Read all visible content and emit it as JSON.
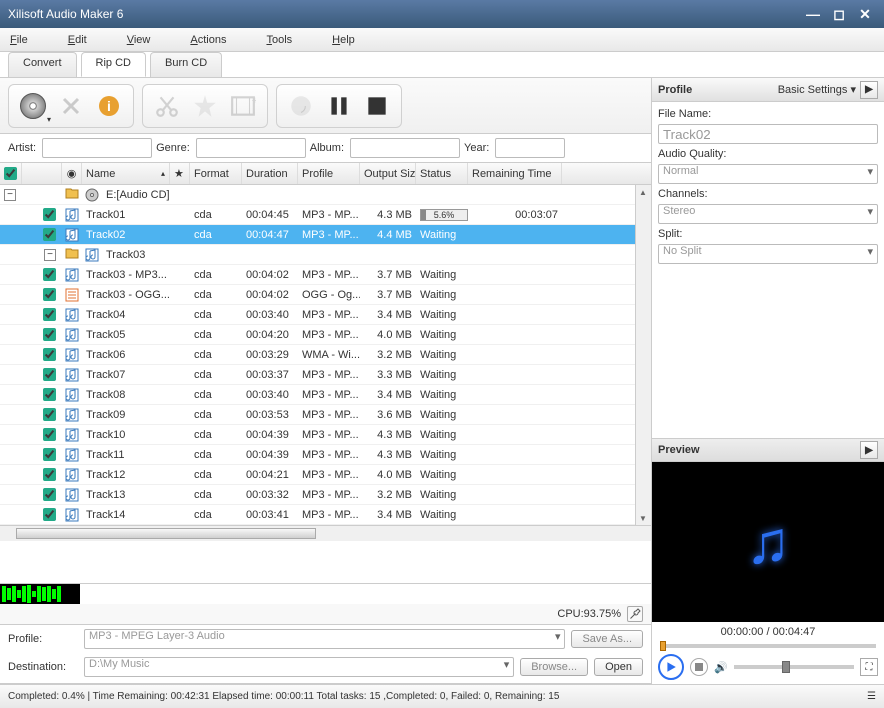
{
  "window": {
    "title": "Xilisoft Audio Maker 6"
  },
  "menu": {
    "file": "File",
    "edit": "Edit",
    "view": "View",
    "actions": "Actions",
    "tools": "Tools",
    "help": "Help"
  },
  "tabs": {
    "convert": "Convert",
    "ripcd": "Rip CD",
    "burncd": "Burn CD"
  },
  "meta": {
    "artist_label": "Artist:",
    "genre_label": "Genre:",
    "album_label": "Album:",
    "year_label": "Year:"
  },
  "headers": {
    "name": "Name",
    "format": "Format",
    "duration": "Duration",
    "profile": "Profile",
    "output_size": "Output Size",
    "status": "Status",
    "remaining_time": "Remaining Time"
  },
  "folders": {
    "cd": "E:[Audio CD]",
    "track03": "Track03"
  },
  "tracks": [
    {
      "name": "Track01",
      "format": "cda",
      "duration": "00:04:45",
      "profile": "MP3 - MP...",
      "output": "4.3 MB",
      "status_pct": "5.6%",
      "remaining": "00:03:07",
      "selected": false,
      "progress": true
    },
    {
      "name": "Track02",
      "format": "cda",
      "duration": "00:04:47",
      "profile": "MP3 - MP...",
      "output": "4.4 MB",
      "status": "Waiting",
      "remaining": "",
      "selected": true
    },
    {
      "name": "Track03 - MP3...",
      "format": "cda",
      "duration": "00:04:02",
      "profile": "MP3 - MP...",
      "output": "3.7 MB",
      "status": "Waiting",
      "remaining": ""
    },
    {
      "name": "Track03 - OGG...",
      "format": "cda",
      "duration": "00:04:02",
      "profile": "OGG - Og...",
      "output": "3.7 MB",
      "status": "Waiting",
      "remaining": "",
      "ogg": true
    },
    {
      "name": "Track04",
      "format": "cda",
      "duration": "00:03:40",
      "profile": "MP3 - MP...",
      "output": "3.4 MB",
      "status": "Waiting",
      "remaining": ""
    },
    {
      "name": "Track05",
      "format": "cda",
      "duration": "00:04:20",
      "profile": "MP3 - MP...",
      "output": "4.0 MB",
      "status": "Waiting",
      "remaining": ""
    },
    {
      "name": "Track06",
      "format": "cda",
      "duration": "00:03:29",
      "profile": "WMA - Wi...",
      "output": "3.2 MB",
      "status": "Waiting",
      "remaining": ""
    },
    {
      "name": "Track07",
      "format": "cda",
      "duration": "00:03:37",
      "profile": "MP3 - MP...",
      "output": "3.3 MB",
      "status": "Waiting",
      "remaining": ""
    },
    {
      "name": "Track08",
      "format": "cda",
      "duration": "00:03:40",
      "profile": "MP3 - MP...",
      "output": "3.4 MB",
      "status": "Waiting",
      "remaining": ""
    },
    {
      "name": "Track09",
      "format": "cda",
      "duration": "00:03:53",
      "profile": "MP3 - MP...",
      "output": "3.6 MB",
      "status": "Waiting",
      "remaining": ""
    },
    {
      "name": "Track10",
      "format": "cda",
      "duration": "00:04:39",
      "profile": "MP3 - MP...",
      "output": "4.3 MB",
      "status": "Waiting",
      "remaining": ""
    },
    {
      "name": "Track11",
      "format": "cda",
      "duration": "00:04:39",
      "profile": "MP3 - MP...",
      "output": "4.3 MB",
      "status": "Waiting",
      "remaining": ""
    },
    {
      "name": "Track12",
      "format": "cda",
      "duration": "00:04:21",
      "profile": "MP3 - MP...",
      "output": "4.0 MB",
      "status": "Waiting",
      "remaining": ""
    },
    {
      "name": "Track13",
      "format": "cda",
      "duration": "00:03:32",
      "profile": "MP3 - MP...",
      "output": "3.2 MB",
      "status": "Waiting",
      "remaining": ""
    },
    {
      "name": "Track14",
      "format": "cda",
      "duration": "00:03:41",
      "profile": "MP3 - MP...",
      "output": "3.4 MB",
      "status": "Waiting",
      "remaining": ""
    }
  ],
  "cpu": "CPU:93.75%",
  "settings": {
    "profile_label": "Profile:",
    "profile_value": "MP3 - MPEG Layer-3 Audio",
    "destination_label": "Destination:",
    "destination_value": "D:\\My Music",
    "saveas": "Save As...",
    "browse": "Browse...",
    "open": "Open"
  },
  "status": "Completed: 0.4% | Time Remaining: 00:42:31 Elapsed time: 00:00:11 Total tasks: 15 ,Completed: 0, Failed: 0, Remaining: 15",
  "profile_panel": {
    "title": "Profile",
    "basic": "Basic Settings ▾",
    "filename_label": "File Name:",
    "filename_value": "Track02",
    "quality_label": "Audio Quality:",
    "quality_value": "Normal",
    "channels_label": "Channels:",
    "channels_value": "Stereo",
    "split_label": "Split:",
    "split_value": "No Split"
  },
  "preview": {
    "title": "Preview",
    "time": "00:00:00 / 00:04:47"
  }
}
